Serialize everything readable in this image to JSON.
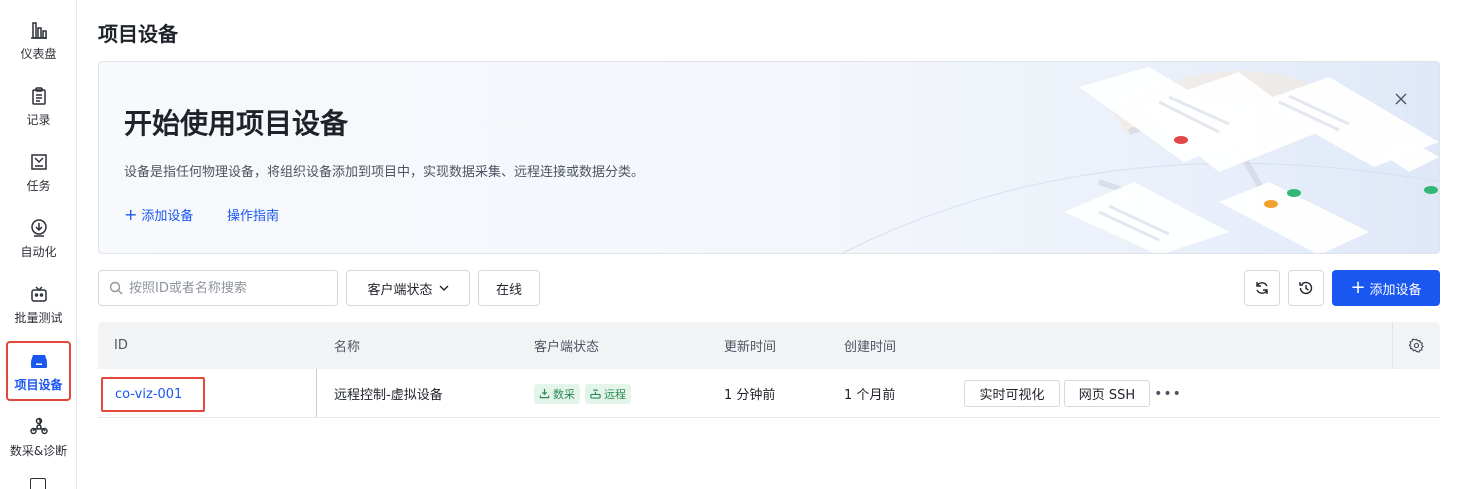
{
  "sidebar": {
    "items": [
      {
        "label": "仪表盘",
        "icon": "bar-chart-icon"
      },
      {
        "label": "记录",
        "icon": "clipboard-icon"
      },
      {
        "label": "任务",
        "icon": "task-icon"
      },
      {
        "label": "自动化",
        "icon": "automation-icon"
      },
      {
        "label": "批量测试",
        "icon": "robot-icon"
      },
      {
        "label": "项目设备",
        "icon": "device-icon",
        "active": true
      },
      {
        "label": "数采&诊断",
        "icon": "radiation-icon"
      }
    ]
  },
  "page": {
    "title": "项目设备"
  },
  "banner": {
    "title": "开始使用项目设备",
    "description": "设备是指任何物理设备，将组织设备添加到项目中，实现数据采集、远程连接或数据分类。",
    "add_link": "添加设备",
    "guide_link": "操作指南"
  },
  "toolbar": {
    "search_placeholder": "按照ID或者名称搜索",
    "client_status_label": "客户端状态",
    "online_label": "在线",
    "add_button_label": "添加设备"
  },
  "table": {
    "columns": [
      "ID",
      "名称",
      "客户端状态",
      "更新时间",
      "创建时间"
    ],
    "rows": [
      {
        "id": "co-viz-001",
        "name": "远程控制-虚拟设备",
        "tags": [
          "数采",
          "远程"
        ],
        "updated": "1 分钟前",
        "created": "1 个月前",
        "actions": [
          "实时可视化",
          "网页 SSH"
        ]
      }
    ]
  },
  "colors": {
    "primary": "#1a56f0",
    "highlight_border": "#e4463a",
    "tag_bg": "#e3f5ea",
    "tag_text": "#2e8b57"
  }
}
